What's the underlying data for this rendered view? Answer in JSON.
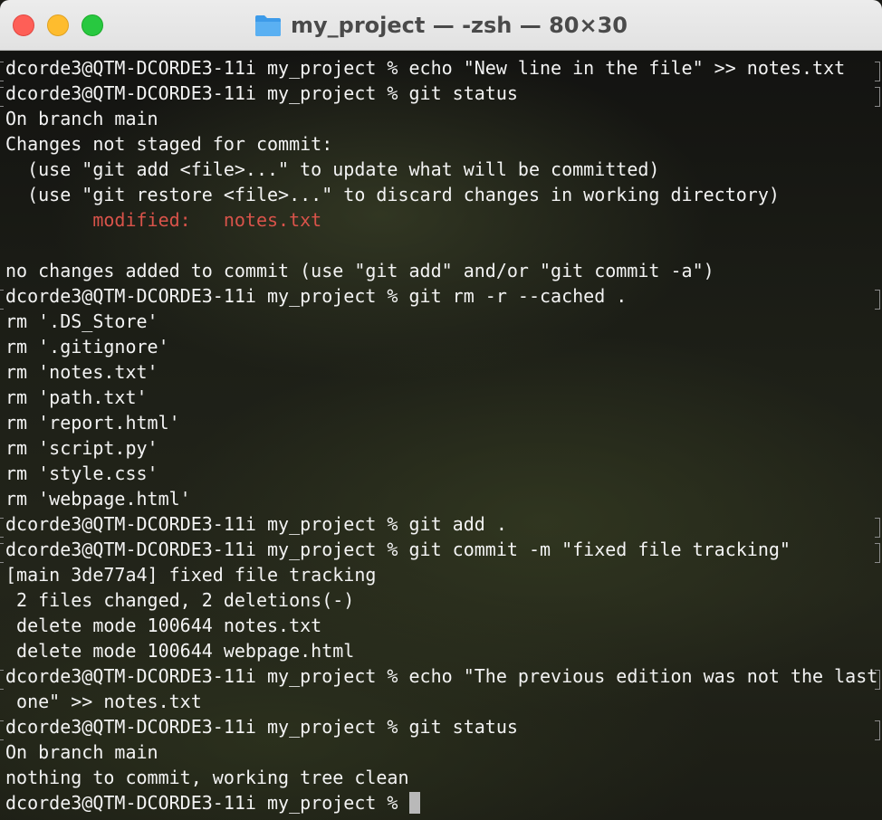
{
  "window": {
    "title": "my_project — -zsh — 80×30",
    "folder_icon": "folder-icon"
  },
  "terminal": {
    "lines": [
      {
        "text": "dcorde3@QTM-DCORDE3-11i my_project % echo \"New line in the file\" >> notes.txt",
        "prompt": true
      },
      {
        "text": "dcorde3@QTM-DCORDE3-11i my_project % git status",
        "prompt": true
      },
      {
        "text": "On branch main",
        "prompt": false
      },
      {
        "text": "Changes not staged for commit:",
        "prompt": false
      },
      {
        "text": "  (use \"git add <file>...\" to update what will be committed)",
        "prompt": false
      },
      {
        "text": "  (use \"git restore <file>...\" to discard changes in working directory)",
        "prompt": false
      },
      {
        "text": "        modified:   notes.txt",
        "prompt": false,
        "color": "red"
      },
      {
        "text": "",
        "prompt": false
      },
      {
        "text": "no changes added to commit (use \"git add\" and/or \"git commit -a\")",
        "prompt": false
      },
      {
        "text": "dcorde3@QTM-DCORDE3-11i my_project % git rm -r --cached .",
        "prompt": true
      },
      {
        "text": "rm '.DS_Store'",
        "prompt": false
      },
      {
        "text": "rm '.gitignore'",
        "prompt": false
      },
      {
        "text": "rm 'notes.txt'",
        "prompt": false
      },
      {
        "text": "rm 'path.txt'",
        "prompt": false
      },
      {
        "text": "rm 'report.html'",
        "prompt": false
      },
      {
        "text": "rm 'script.py'",
        "prompt": false
      },
      {
        "text": "rm 'style.css'",
        "prompt": false
      },
      {
        "text": "rm 'webpage.html'",
        "prompt": false
      },
      {
        "text": "dcorde3@QTM-DCORDE3-11i my_project % git add .",
        "prompt": true
      },
      {
        "text": "dcorde3@QTM-DCORDE3-11i my_project % git commit -m \"fixed file tracking\"",
        "prompt": true
      },
      {
        "text": "[main 3de77a4] fixed file tracking",
        "prompt": false
      },
      {
        "text": " 2 files changed, 2 deletions(-)",
        "prompt": false
      },
      {
        "text": " delete mode 100644 notes.txt",
        "prompt": false
      },
      {
        "text": " delete mode 100644 webpage.html",
        "prompt": false
      },
      {
        "text": "dcorde3@QTM-DCORDE3-11i my_project % echo \"The previous edition was not the last",
        "prompt": true
      },
      {
        "text": " one\" >> notes.txt",
        "prompt": false
      },
      {
        "text": "dcorde3@QTM-DCORDE3-11i my_project % git status",
        "prompt": true
      },
      {
        "text": "On branch main",
        "prompt": false
      },
      {
        "text": "nothing to commit, working tree clean",
        "prompt": false
      }
    ],
    "current_prompt": "dcorde3@QTM-DCORDE3-11i my_project % ",
    "colors": {
      "text": "#f3f3f3",
      "modified": "#d9534a"
    }
  }
}
